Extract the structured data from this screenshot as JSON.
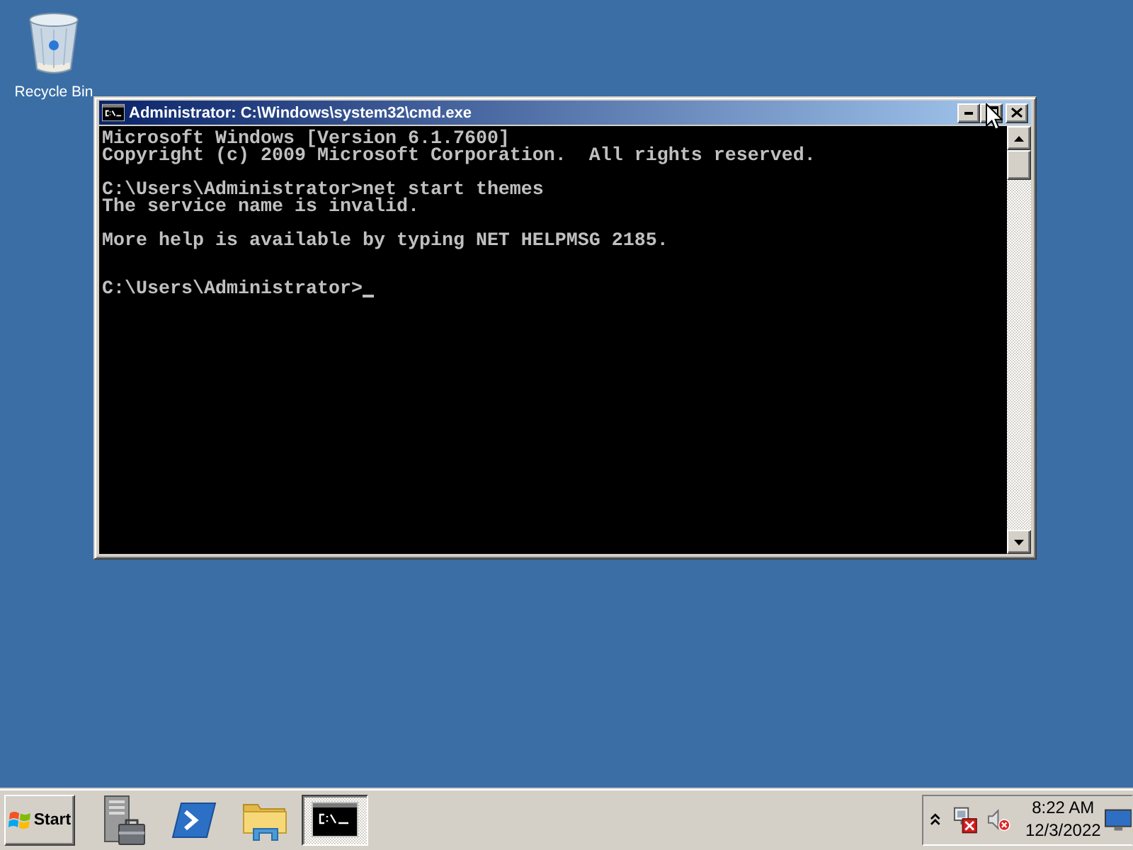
{
  "desktop": {
    "icons": [
      {
        "kind": "recycle-bin",
        "label": "Recycle Bin"
      }
    ]
  },
  "window": {
    "title": "Administrator: C:\\Windows\\system32\\cmd.exe",
    "active": true
  },
  "console": {
    "lines": [
      {
        "kind": "text",
        "text": "Microsoft Windows [Version 6.1.7600]"
      },
      {
        "kind": "text",
        "text": "Copyright (c) 2009 Microsoft Corporation.  All rights reserved."
      },
      {
        "kind": "blank"
      },
      {
        "kind": "text",
        "text": "C:\\Users\\Administrator>net start themes"
      },
      {
        "kind": "text",
        "text": "The service name is invalid."
      },
      {
        "kind": "blank"
      },
      {
        "kind": "text",
        "text": "More help is available by typing NET HELPMSG 2185."
      },
      {
        "kind": "blank"
      },
      {
        "kind": "blank"
      },
      {
        "kind": "prompt",
        "text": "C:\\Users\\Administrator>"
      }
    ]
  },
  "taskbar": {
    "start": {
      "label": "Start"
    },
    "quick_launch": [
      {
        "kind": "server-manager",
        "selected": false
      },
      {
        "kind": "powershell",
        "selected": false
      },
      {
        "kind": "explorer",
        "selected": false
      },
      {
        "kind": "console",
        "selected": true
      }
    ],
    "tray": {
      "time": "8:22 AM",
      "date": "12/3/2022"
    }
  }
}
